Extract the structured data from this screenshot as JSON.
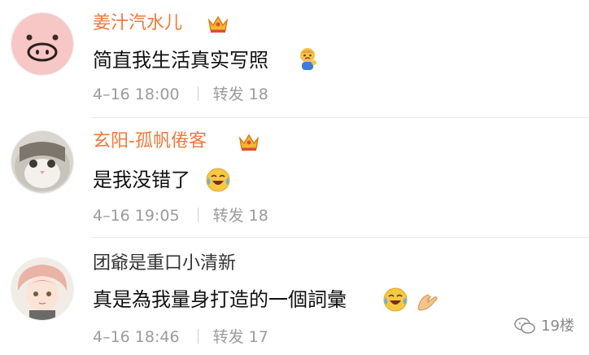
{
  "comments": [
    {
      "username": "姜汁汽水儿",
      "vip": true,
      "content": "简直我生活真实写照",
      "emoji_after": [
        "kid-thinking-emoji"
      ],
      "time": "4–16 18:00",
      "repost_label": "转发",
      "repost_count": "18",
      "avatar": "pig-face-avatar"
    },
    {
      "username": "玄阳-孤帆倦客",
      "vip": true,
      "content": "是我没错了",
      "emoji_after": [
        "laugh-cry-emoji"
      ],
      "time": "4–16 19:05",
      "repost_label": "转发",
      "repost_count": "18",
      "avatar": "cat-avatar"
    },
    {
      "username": "团爺是重口小清新",
      "vip": false,
      "content": "真是為我量身打造的一個詞彙",
      "emoji_after": [
        "laugh-cry-emoji",
        "hands-emoji"
      ],
      "time": "4–16 18:46",
      "repost_label": "转发",
      "repost_count": "17",
      "avatar": "anime-character-avatar"
    }
  ],
  "watermark": {
    "text": "19楼",
    "icon": "wechat-icon"
  },
  "colors": {
    "vip_name": "#f1793a",
    "meta": "#9b9b9b",
    "divider": "#e6e6e6"
  }
}
